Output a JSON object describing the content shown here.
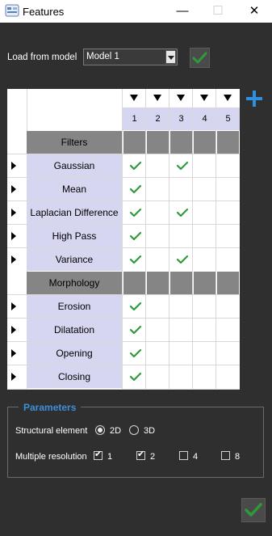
{
  "window": {
    "title": "Features",
    "minimize_glyph": "—",
    "maximize_glyph": "☐",
    "close_glyph": "✕"
  },
  "load": {
    "label": "Load from model",
    "selected": "Model 1"
  },
  "table": {
    "columns": [
      "1",
      "2",
      "3",
      "4",
      "5"
    ],
    "sections": [
      {
        "title": "Filters",
        "rows": [
          {
            "label": "Gaussian",
            "checks": [
              true,
              false,
              true,
              false,
              false
            ]
          },
          {
            "label": "Mean",
            "checks": [
              true,
              false,
              false,
              false,
              false
            ]
          },
          {
            "label": "Laplacian Difference",
            "checks": [
              true,
              false,
              true,
              false,
              false
            ]
          },
          {
            "label": "High Pass",
            "checks": [
              true,
              false,
              false,
              false,
              false
            ]
          },
          {
            "label": "Variance",
            "checks": [
              true,
              false,
              true,
              false,
              false
            ]
          }
        ]
      },
      {
        "title": "Morphology",
        "rows": [
          {
            "label": "Erosion",
            "checks": [
              true,
              false,
              false,
              false,
              false
            ]
          },
          {
            "label": "Dilatation",
            "checks": [
              true,
              false,
              false,
              false,
              false
            ]
          },
          {
            "label": "Opening",
            "checks": [
              true,
              false,
              false,
              false,
              false
            ]
          },
          {
            "label": "Closing",
            "checks": [
              true,
              false,
              false,
              false,
              false
            ]
          }
        ]
      }
    ]
  },
  "parameters": {
    "legend": "Parameters",
    "structural_label": "Structural element",
    "structural_options": [
      {
        "label": "2D",
        "selected": true
      },
      {
        "label": "3D",
        "selected": false
      }
    ],
    "multires_label": "Multiple resolution",
    "multires_options": [
      {
        "label": "1",
        "checked": true
      },
      {
        "label": "2",
        "checked": true
      },
      {
        "label": "4",
        "checked": false
      },
      {
        "label": "8",
        "checked": false
      }
    ]
  },
  "icons": {
    "app": "app-logo-icon",
    "confirm": "checkmark-icon",
    "add": "plus-icon",
    "row_expand": "expand-arrow-icon",
    "column_menu": "column-dropdown-icon"
  },
  "colors": {
    "background": "#2f2f2f",
    "check_green": "#2e9a3a",
    "header_blue": "#d6d6f0",
    "section_gray": "#858585",
    "legend_blue": "#3d8fd8",
    "add_blue": "#2f8fe0"
  }
}
